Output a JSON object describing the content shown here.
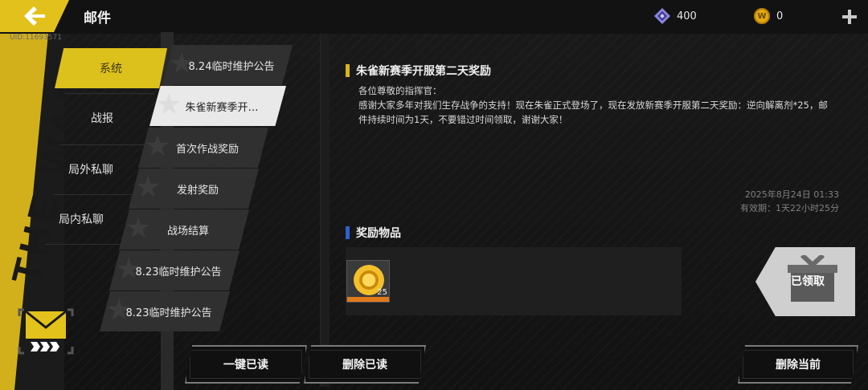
{
  "header": {
    "title": "邮件",
    "uid": "UID:11693571",
    "gems": "400",
    "gold_symbol": "W",
    "gold": "0"
  },
  "deco": {
    "band_text": "THE WAR",
    "accent_color": "#dcc11d"
  },
  "categories": [
    {
      "label": "系统",
      "active": true
    },
    {
      "label": "战报",
      "active": false
    },
    {
      "label": "局外私聊",
      "active": false
    },
    {
      "label": "局内私聊",
      "active": false
    }
  ],
  "mails": [
    {
      "label": "8.24临时维护公告"
    },
    {
      "label": "朱雀新赛季开…",
      "selected": true
    },
    {
      "label": "首次作战奖励"
    },
    {
      "label": "发射奖励"
    },
    {
      "label": "战场结算"
    },
    {
      "label": "8.23临时维护公告"
    },
    {
      "label": "8.23临时维护公告"
    }
  ],
  "mail_detail": {
    "subject": "朱雀新赛季开服第二天奖励",
    "greeting": "各位尊敬的指挥官：",
    "body": "感谢大家多年对我们生存战争的支持！现在朱雀正式登场了，现在发放新赛季开服第二天奖励：逆向解离剂*25，邮件持续时间为1天，不要错过时间领取，谢谢大家！",
    "date": "2025年8月24日  01:33",
    "validity": "有效期：1天22小时25分",
    "rewards_title": "奖励物品",
    "reward_items": [
      {
        "icon": "gold-coin-icon",
        "count": "25"
      }
    ],
    "claimed_label": "已领取"
  },
  "buttons": {
    "read_all": "一键已读",
    "delete_read": "删除已读",
    "delete_current": "删除当前"
  }
}
